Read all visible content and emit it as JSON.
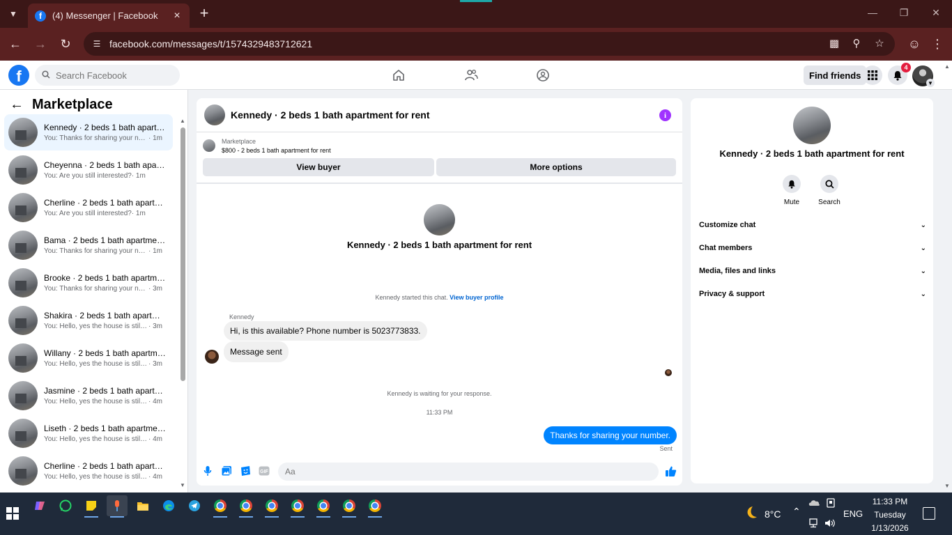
{
  "browser": {
    "tab_title": "(4) Messenger | Facebook",
    "url": "facebook.com/messages/t/1574329483712621"
  },
  "header": {
    "search_placeholder": "Search Facebook",
    "find_friends": "Find friends",
    "notification_count": "4"
  },
  "sidebar": {
    "title": "Marketplace",
    "conversations": [
      {
        "name": "Kennedy · 2 beds 1 bath apartm...",
        "preview": "You: Thanks for sharing your num...",
        "time": "· 1m",
        "active": true
      },
      {
        "name": "Cheyenna · 2 beds 1 bath apart...",
        "preview": "You: Are you still interested?",
        "time": "· 1m"
      },
      {
        "name": "Cherline · 2 beds 1 bath apartm...",
        "preview": "You: Are you still interested?",
        "time": "· 1m"
      },
      {
        "name": "Bama · 2 beds 1 bath apartment...",
        "preview": "You: Thanks for sharing your num...",
        "time": "· 1m"
      },
      {
        "name": "Brooke · 2 beds 1 bath apartme...",
        "preview": "You: Thanks for sharing your num...",
        "time": "· 3m"
      },
      {
        "name": "Shakira · 2 beds 1 bath apartme...",
        "preview": "You: Hello, yes the house is still av...",
        "time": "· 3m"
      },
      {
        "name": "Willany · 2 beds 1 bath apartme...",
        "preview": "You: Hello, yes the house is still av...",
        "time": "· 3m"
      },
      {
        "name": "Jasmine · 2 beds 1 bath apartm...",
        "preview": "You: Hello, yes the house is still av...",
        "time": "· 4m"
      },
      {
        "name": "Liseth · 2 beds 1 bath apartmen...",
        "preview": "You: Hello, yes the house is still av...",
        "time": "· 4m"
      },
      {
        "name": "Cherline · 2 beds 1 bath apartm...",
        "preview": "You: Hello, yes the house is still av...",
        "time": "· 4m"
      }
    ]
  },
  "chat": {
    "title": "Kennedy · 2 beds 1 bath apartment for rent",
    "marketplace_label": "Marketplace",
    "listing": "$800 - 2 beds 1 bath apartment for rent",
    "view_buyer": "View buyer",
    "more_options": "More options",
    "intro_title": "Kennedy · 2 beds 1 bath apartment for rent",
    "started_text": "Kennedy started this chat.",
    "view_buyer_profile": "View buyer profile",
    "sender_name": "Kennedy",
    "incoming_1": "Hi, is this available? Phone number is 5023773833.",
    "incoming_2": "Message sent",
    "waiting_text": "Kennedy is waiting for your response.",
    "timestamp": "11:33 PM",
    "outgoing_1": "Thanks for sharing your number.",
    "sent_label": "Sent",
    "composer_placeholder": "Aa"
  },
  "info_panel": {
    "title": "Kennedy · 2 beds 1 bath apartment for rent",
    "mute": "Mute",
    "search": "Search",
    "sections": [
      "Customize chat",
      "Chat members",
      "Media, files and links",
      "Privacy & support"
    ]
  },
  "taskbar": {
    "temperature": "8°C",
    "language": "ENG",
    "time": "11:33 PM",
    "day": "Tuesday",
    "date": "1/13/2026"
  }
}
